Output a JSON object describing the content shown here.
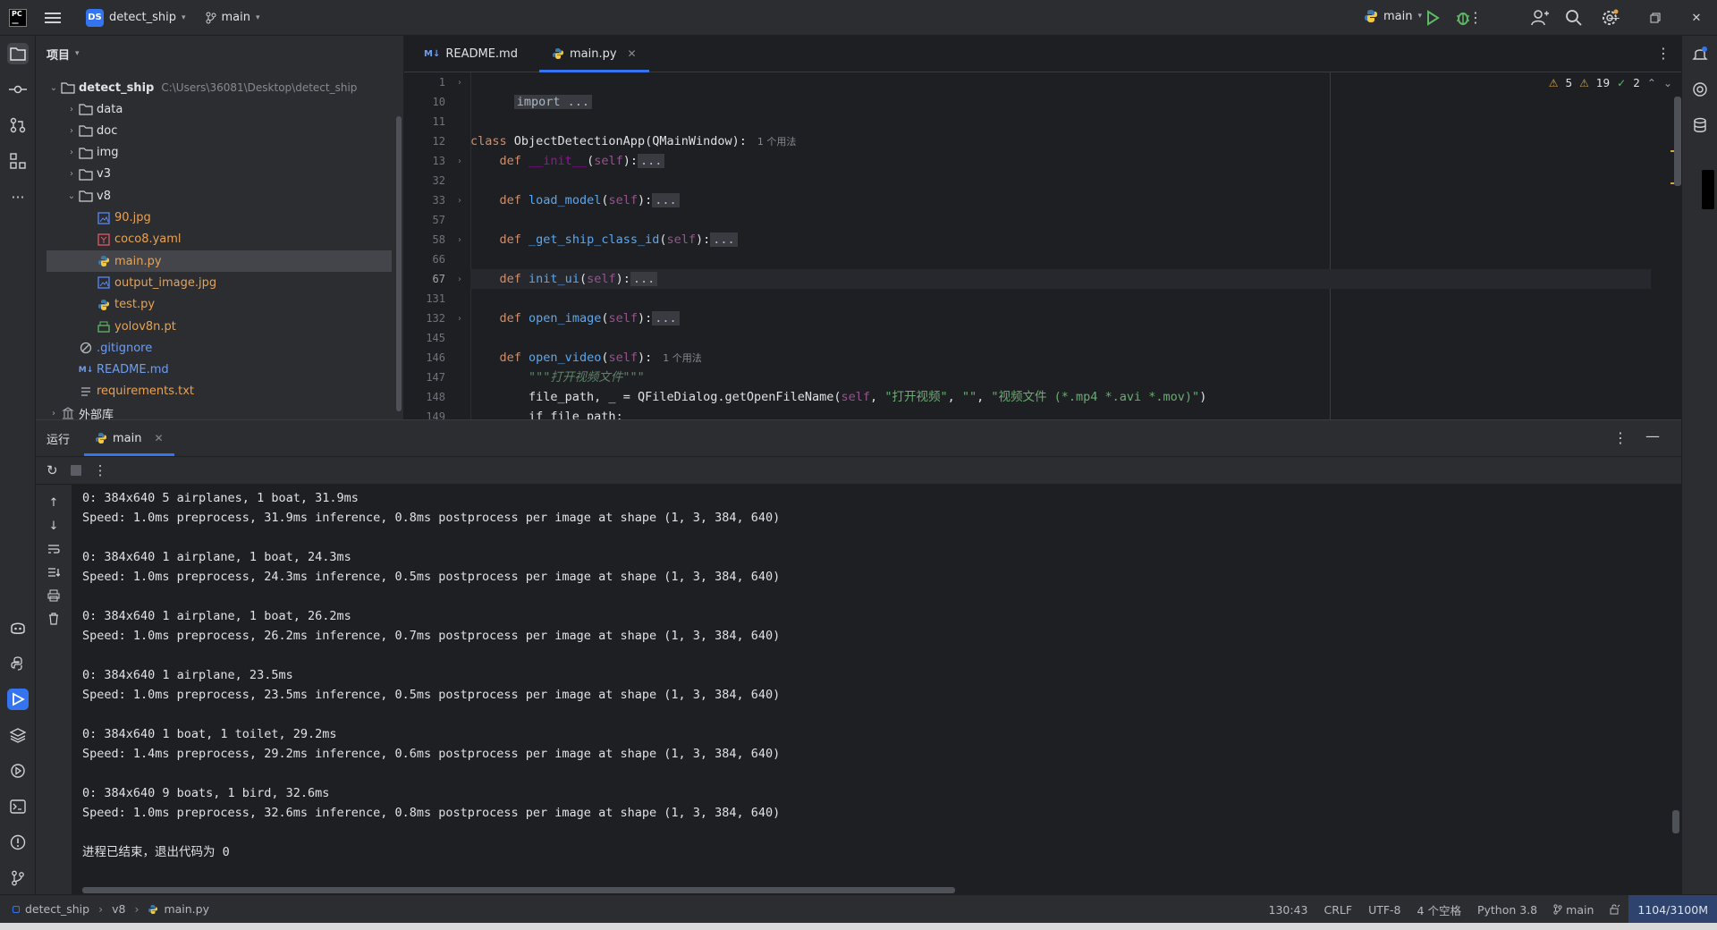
{
  "titlebar": {
    "project_badge": "DS",
    "project_name": "detect_ship",
    "branch": "main",
    "run_config": "main"
  },
  "project_panel": {
    "title": "项目",
    "root": {
      "name": "detect_ship",
      "path": "C:\\Users\\36081\\Desktop\\detect_ship"
    },
    "items": [
      {
        "label": "data",
        "type": "folder"
      },
      {
        "label": "doc",
        "type": "folder"
      },
      {
        "label": "img",
        "type": "folder"
      },
      {
        "label": "v3",
        "type": "folder"
      },
      {
        "label": "v8",
        "type": "folder-open"
      },
      {
        "label": "90.jpg",
        "type": "image"
      },
      {
        "label": "coco8.yaml",
        "type": "yaml"
      },
      {
        "label": "main.py",
        "type": "python"
      },
      {
        "label": "output_image.jpg",
        "type": "image"
      },
      {
        "label": "test.py",
        "type": "python"
      },
      {
        "label": "yolov8n.pt",
        "type": "binary"
      },
      {
        "label": ".gitignore",
        "type": "ignore"
      },
      {
        "label": "README.md",
        "type": "markdown"
      },
      {
        "label": "requirements.txt",
        "type": "text"
      },
      {
        "label": "外部库",
        "type": "library"
      }
    ]
  },
  "editor": {
    "tabs": [
      {
        "label": "README.md",
        "icon": "markdown-icon"
      },
      {
        "label": "main.py",
        "icon": "python-icon"
      }
    ],
    "indicators": {
      "warnings": "5",
      "weak_warnings": "19",
      "ok": "2"
    },
    "line_numbers": [
      "1",
      "10",
      "11",
      "12",
      "13",
      "32",
      "33",
      "57",
      "58",
      "66",
      "67",
      "131",
      "132",
      "145",
      "146",
      "147",
      "148",
      "149"
    ],
    "code": {
      "l1": "import ...",
      "l12_kw": "class",
      "l12_rest": " ObjectDetectionApp(QMainWindow):",
      "l12_hint": "1 个用法",
      "l13_fn": "__init__",
      "l33_fn": "load_model",
      "l58_fn": "_get_ship_class_id",
      "l67_fn": "init_ui",
      "l132_fn": "open_image",
      "l146_fn": "open_video",
      "l146_hint": "1 个用法",
      "l147_doc": "\"\"\"打开视频文件\"\"\"",
      "l148_a": "file_path, _ = QFileDialog.getOpenFileName(",
      "l148_s1": "\"打开视频\"",
      "l148_s2": "\"\"",
      "l148_s3": "\"视频文件 (*.mp4 *.avi *.mov)\"",
      "l149": "if file_path:",
      "def": "def",
      "self": "self",
      "folded": "..."
    }
  },
  "run_panel": {
    "label": "运行",
    "tab": "main",
    "output": [
      "0: 384x640 5 airplanes, 1 boat, 31.9ms",
      "Speed: 1.0ms preprocess, 31.9ms inference, 0.8ms postprocess per image at shape (1, 3, 384, 640)",
      "",
      "0: 384x640 1 airplane, 1 boat, 24.3ms",
      "Speed: 1.0ms preprocess, 24.3ms inference, 0.5ms postprocess per image at shape (1, 3, 384, 640)",
      "",
      "0: 384x640 1 airplane, 1 boat, 26.2ms",
      "Speed: 1.0ms preprocess, 26.2ms inference, 0.7ms postprocess per image at shape (1, 3, 384, 640)",
      "",
      "0: 384x640 1 airplane, 23.5ms",
      "Speed: 1.0ms preprocess, 23.5ms inference, 0.5ms postprocess per image at shape (1, 3, 384, 640)",
      "",
      "0: 384x640 1 boat, 1 toilet, 29.2ms",
      "Speed: 1.4ms preprocess, 29.2ms inference, 0.6ms postprocess per image at shape (1, 3, 384, 640)",
      "",
      "0: 384x640 9 boats, 1 bird, 32.6ms",
      "Speed: 1.0ms preprocess, 32.6ms inference, 0.8ms postprocess per image at shape (1, 3, 384, 640)",
      "",
      "进程已结束，退出代码为 0"
    ]
  },
  "statusbar": {
    "breadcrumb": [
      "detect_ship",
      "v8",
      "main.py"
    ],
    "position": "130:43",
    "line_sep": "CRLF",
    "encoding": "UTF-8",
    "indent": "4 个空格",
    "interpreter": "Python 3.8",
    "branch": "main",
    "memory": "1104/3100M"
  },
  "colors": {
    "accent": "#3574f0",
    "bg": "#1e1f22",
    "panel": "#2b2d30"
  }
}
